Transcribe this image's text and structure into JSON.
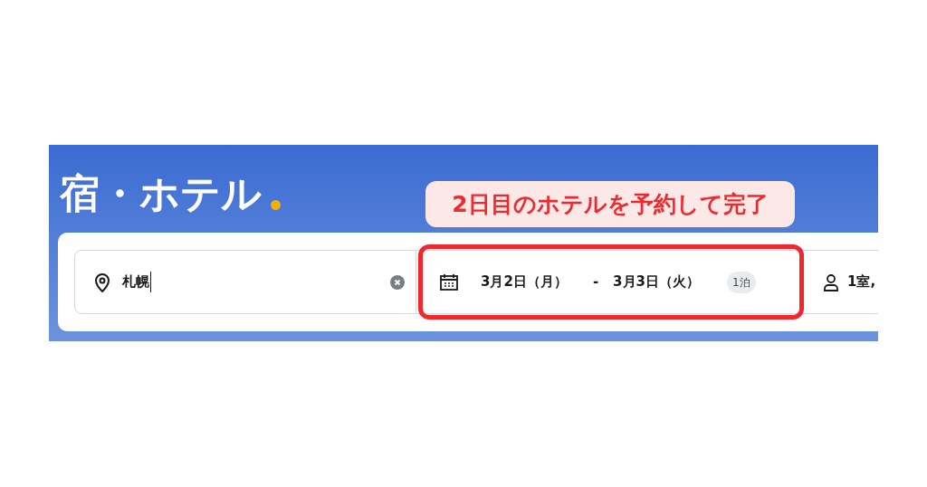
{
  "title": "宿・ホテル",
  "annotation": "2日目のホテルを予約して完了",
  "search": {
    "destination": "札幌",
    "check_in": "3月2日（月）",
    "separator": "-",
    "check_out": "3月3日（火）",
    "nights": "1泊",
    "guests": "1室,"
  }
}
